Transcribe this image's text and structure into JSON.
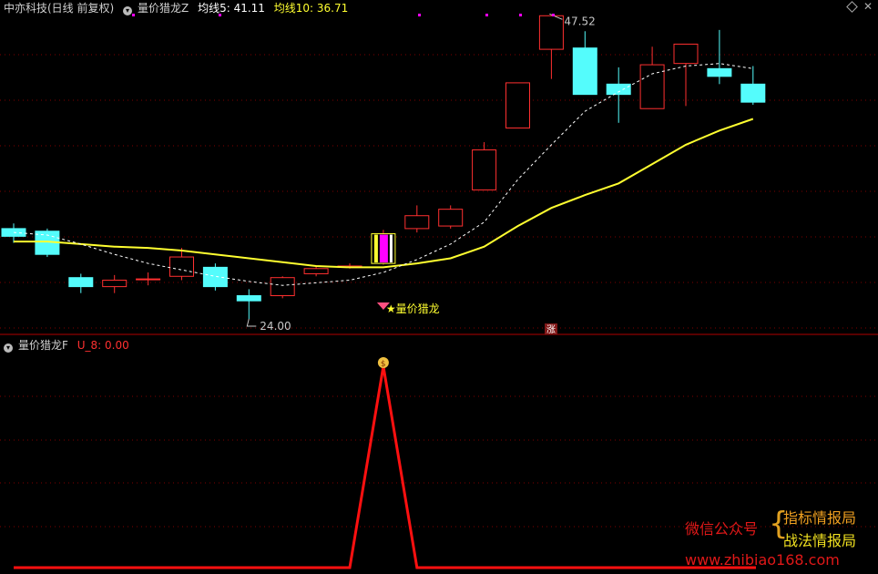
{
  "top_header": {
    "stock": "中亦科技(日线 前复权)",
    "indicator": "量价猎龙Z",
    "ma5_label": "均线5: 41.11",
    "ma10_label": "均线10: 36.71"
  },
  "bottom_header": {
    "indicator": "量价猎龙F",
    "value_label": "U_8: 0.00"
  },
  "annotations": {
    "high_label": "47.52",
    "low_label": "24.00",
    "signal_label": "★量价猎龙",
    "zhang_label": "涨",
    "money_label": "$"
  },
  "watermark": {
    "left": "微信公众号",
    "brace": "{",
    "right1": "指标情报局",
    "right2": "战法情报局",
    "url": "www.zhibiao168.com"
  },
  "colors": {
    "up": "#ff3030",
    "down": "#54fcfc",
    "ma5": "#ffffff",
    "ma10": "#ffff30",
    "grid": "#800000",
    "signal_line": "#ff1010",
    "magenta": "#ff00ff"
  },
  "chart_data": [
    {
      "type": "candlestick",
      "price_range": [
        20,
        50
      ],
      "candles": [
        {
          "o": 31.0,
          "c": 30.4,
          "h": 31.4,
          "l": 29.9
        },
        {
          "o": 30.8,
          "c": 29.0,
          "h": 31.0,
          "l": 28.8
        },
        {
          "o": 27.2,
          "c": 26.5,
          "h": 27.5,
          "l": 26.0
        },
        {
          "o": 26.5,
          "c": 27.0,
          "h": 27.4,
          "l": 26.0
        },
        {
          "o": 27.1,
          "c": 27.1,
          "h": 27.6,
          "l": 26.6
        },
        {
          "o": 27.3,
          "c": 28.8,
          "h": 29.5,
          "l": 27.0
        },
        {
          "o": 28.0,
          "c": 26.5,
          "h": 28.3,
          "l": 26.2
        },
        {
          "o": 25.8,
          "c": 25.4,
          "h": 26.3,
          "l": 24.0
        },
        {
          "o": 25.8,
          "c": 27.2,
          "h": 27.3,
          "l": 25.6
        },
        {
          "o": 27.5,
          "c": 27.9,
          "h": 28.1,
          "l": 27.3
        },
        {
          "o": 28.0,
          "c": 28.1,
          "h": 28.3,
          "l": 27.9
        },
        {
          "o": 28.3,
          "c": 30.6,
          "h": 30.9,
          "l": 28.2
        },
        {
          "o": 31.0,
          "c": 32.0,
          "h": 32.8,
          "l": 30.7
        },
        {
          "o": 31.2,
          "c": 32.5,
          "h": 32.8,
          "l": 31.0
        },
        {
          "o": 34.0,
          "c": 37.1,
          "h": 37.7,
          "l": 34.0
        },
        {
          "o": 38.8,
          "c": 42.3,
          "h": 42.3,
          "l": 38.8
        },
        {
          "o": 44.9,
          "c": 47.5,
          "h": 47.5,
          "l": 42.6
        },
        {
          "o": 45.0,
          "c": 41.4,
          "h": 46.3,
          "l": 41.4
        },
        {
          "o": 42.2,
          "c": 41.4,
          "h": 43.5,
          "l": 39.2
        },
        {
          "o": 40.3,
          "c": 43.7,
          "h": 45.1,
          "l": 40.3
        },
        {
          "o": 43.8,
          "c": 45.3,
          "h": 45.3,
          "l": 40.5
        },
        {
          "o": 43.4,
          "c": 42.8,
          "h": 46.4,
          "l": 42.2
        },
        {
          "o": 42.2,
          "c": 40.8,
          "h": 43.6,
          "l": 40.6
        }
      ],
      "ma5": [
        30.7,
        30.5,
        29.8,
        29.0,
        28.3,
        27.8,
        27.3,
        26.9,
        26.6,
        26.8,
        27.0,
        27.6,
        28.6,
        29.8,
        31.5,
        34.8,
        37.5,
        40.1,
        41.6,
        43.0,
        43.6,
        43.8,
        43.4
      ],
      "ma10": [
        30.0,
        30.0,
        29.8,
        29.6,
        29.5,
        29.3,
        29.0,
        28.7,
        28.4,
        28.1,
        28.0,
        28.0,
        28.3,
        28.7,
        29.6,
        31.2,
        32.6,
        33.6,
        34.5,
        36.0,
        37.5,
        38.6,
        39.5
      ],
      "signal_index": 11
    },
    {
      "type": "line",
      "name": "U_8",
      "y_range": [
        0,
        1
      ],
      "values": [
        0,
        0,
        0,
        0,
        0,
        0,
        0,
        0,
        0,
        0,
        0,
        1,
        0,
        0,
        0,
        0,
        0,
        0,
        0,
        0,
        0,
        0,
        0
      ]
    }
  ]
}
